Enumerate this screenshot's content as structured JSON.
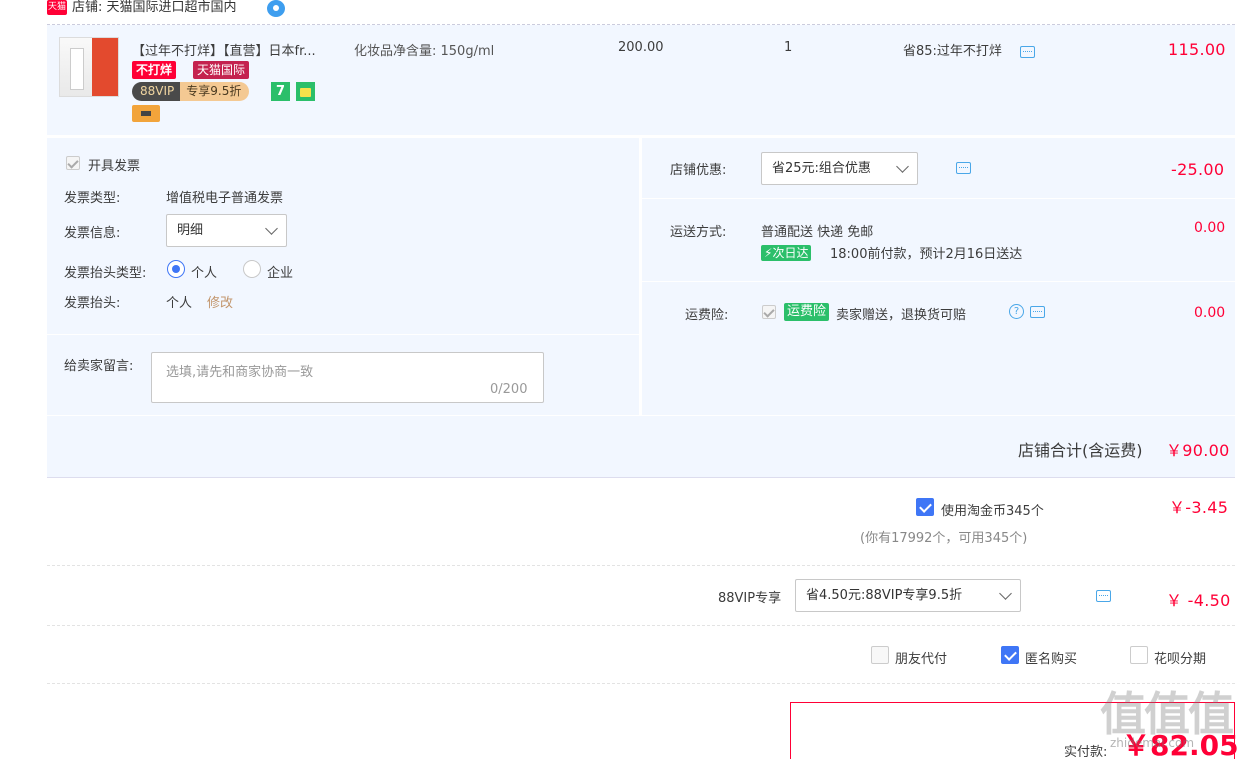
{
  "shop": {
    "badge": "天猫",
    "name": "店铺: 天猫国际进口超市国内"
  },
  "item": {
    "title": "【过年不打烊】【直营】日本fr...",
    "sku": "化妆品净含量: 150g/ml",
    "tag_nodayang": "不打烊",
    "tag_tmall": "天猫国际",
    "vip_left": "88VIP",
    "vip_right": "专享9.5折",
    "seven": "7",
    "unit_price": "200.00",
    "quantity": "1",
    "promo": "省85:过年不打烊",
    "total": "115.00"
  },
  "invoice": {
    "checkbox_label": "开具发票",
    "type_label": "发票类型:",
    "type_value": "增值税电子普通发票",
    "info_label": "发票信息:",
    "info_value": "明细",
    "header_type_label": "发票抬头类型:",
    "header_type_options": [
      "个人",
      "企业"
    ],
    "header_label": "发票抬头:",
    "header_value": "个人",
    "edit_link": "修改"
  },
  "message": {
    "label": "给卖家留言:",
    "placeholder": "选填,请先和商家协商一致",
    "counter": "0/200"
  },
  "shop_discount": {
    "label": "店铺优惠:",
    "selected": "省25元:组合优惠",
    "amount": "-25.00"
  },
  "shipping": {
    "label": "运送方式:",
    "method": "普通配送 快递 免邮",
    "badge": "次日达",
    "eta": "18:00前付款，预计2月16日送达",
    "amount": "0.00"
  },
  "insurance": {
    "label": "运费险:",
    "badge": "运费险",
    "desc": "卖家赠送，退换货可赔",
    "amount": "0.00"
  },
  "shop_total": {
    "label": "店铺合计(含运费)",
    "amount": "￥90.00"
  },
  "coins": {
    "label": "使用淘金币345个",
    "note": "(你有17992个，可用345个)",
    "amount": "￥-3.45"
  },
  "vip_discount": {
    "label": "88VIP专享",
    "selected": "省4.50元:88VIP专享9.5折",
    "amount": "￥ -4.50"
  },
  "options": {
    "friend_pay": "朋友代付",
    "anonymous": "匿名购买",
    "huabei": "花呗分期"
  },
  "final": {
    "label": "实付款:",
    "amount": "￥82.05"
  },
  "watermark": {
    "logo": "值值值",
    "site": "zhidemai.com"
  },
  "colors": {
    "accent_red": "#ff0036",
    "panel_bg": "#f2f7ff",
    "brand_blue": "#3f76f6",
    "green": "#2bbf6a"
  }
}
